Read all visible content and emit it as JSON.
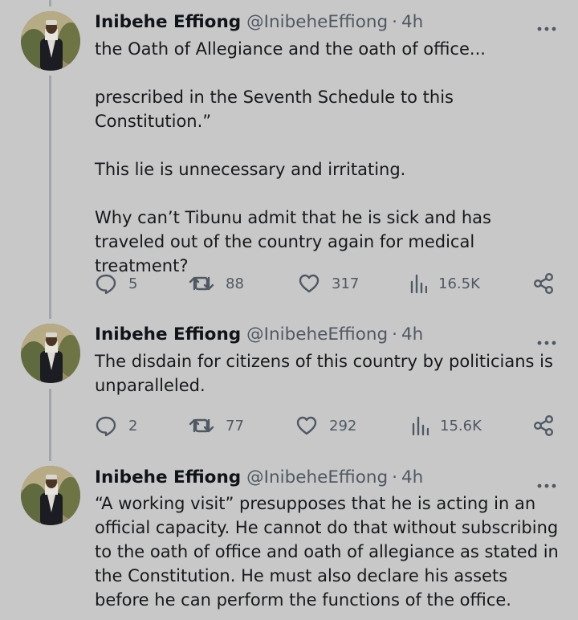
{
  "tweets": [
    {
      "name": "Inibehe Effiong",
      "handle": "@InibeheEffiong",
      "separator": "·",
      "time": "4h",
      "paragraphs": [
        "the Oath of Allegiance and the oath of office...",
        "prescribed in the Seventh Schedule to this Constitution.”",
        "This lie is unnecessary and irritating.",
        "Why can’t Tibunu admit that he is sick and has traveled out of the country again for medical treatment?"
      ],
      "replies": "5",
      "retweets": "88",
      "likes": "317",
      "views": "16.5K"
    },
    {
      "name": "Inibehe Effiong",
      "handle": "@InibeheEffiong",
      "separator": "·",
      "time": "4h",
      "paragraphs": [
        "The disdain for citizens of this country by politicians is unparalleled."
      ],
      "replies": "2",
      "retweets": "77",
      "likes": "292",
      "views": "15.6K"
    },
    {
      "name": "Inibehe Effiong",
      "handle": "@InibeheEffiong",
      "separator": "·",
      "time": "4h",
      "paragraphs": [
        "“A working visit” presupposes that he is acting in an official capacity. He cannot do that without subscribing to the oath of office and oath of allegiance as stated in the Constitution. He must also declare his assets before he can perform the functions of the office."
      ]
    }
  ],
  "icons": {
    "reply": "reply-icon",
    "retweet": "retweet-icon",
    "like": "heart-icon",
    "views": "views-icon",
    "share": "share-icon",
    "more": "more-icon"
  },
  "colors": {
    "background": "#c8c8c8",
    "text": "#16191c",
    "muted": "#4f5963",
    "thread_line": "#a3a6a9"
  }
}
